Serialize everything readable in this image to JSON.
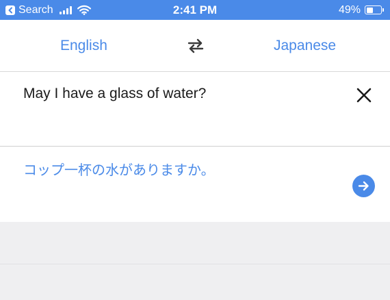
{
  "status_bar": {
    "back_label": "Search",
    "time": "2:41 PM",
    "battery_text": "49%",
    "battery_level": 0.49,
    "signal_bars": 4,
    "icons": [
      "back-arrow-icon",
      "signal-icon",
      "wifi-icon",
      "battery-icon"
    ]
  },
  "languages": {
    "source": "English",
    "target": "Japanese",
    "swap_icon": "swap-arrows-icon"
  },
  "input": {
    "text": "May I have a glass of water?",
    "clear_icon": "close-icon"
  },
  "output": {
    "text": "コップ一杯の水がありますか。",
    "action_icon": "arrow-right-circle-icon"
  },
  "colors": {
    "accent": "#4a8ae8",
    "text": "#1a1a1a",
    "background": "#f0f0f2"
  }
}
